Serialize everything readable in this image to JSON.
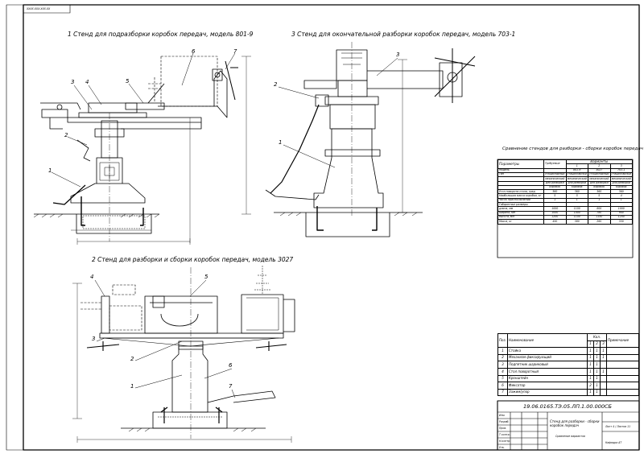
{
  "stamp_top": "ХХХХ.ХХХ.ХХХ.ХХ",
  "view1_title": "1 Стенд для подразборки коробок передач, модель 801-9",
  "view2_title": "2 Стенд для разборки и сборки коробок передач, модель 3027",
  "view3_title": "3 Стенд для окончательной разборки коробок передач, модель 703-1",
  "callouts_v1": [
    "1",
    "2",
    "3",
    "4",
    "5",
    "6",
    "7"
  ],
  "callouts_v2": [
    "1",
    "2",
    "3",
    "4",
    "5",
    "6",
    "7"
  ],
  "callouts_v3": [
    "1",
    "2",
    "3"
  ],
  "comparison": {
    "title": "Сравнение стендов для разборки - сборки коробок передач",
    "col_param": "Параметры",
    "col_req": "Требуемые",
    "col_variants": "Варианты",
    "variant_nums": [
      "1",
      "2",
      "3"
    ],
    "models": [
      "801-9",
      "3027",
      "703-1"
    ],
    "rows": [
      {
        "label": "Модель",
        "req": "",
        "v": [
          "801-9",
          "3027",
          "703-1"
        ]
      },
      {
        "label": "Тип",
        "req": "стационарный",
        "v": [
          "стационарный",
          "стационарный",
          "стационарный"
        ]
      },
      {
        "label": "",
        "req": "механический",
        "v": [
          "механический",
          "механический",
          "механический"
        ]
      },
      {
        "label": "",
        "req": "для разборки",
        "v": [
          "для разборки",
          "для разборки",
          "для разборки"
        ]
      },
      {
        "label": "",
        "req": "коробок",
        "v": [
          "коробок",
          "коробок",
          "коробок"
        ]
      },
      {
        "label": "Угол поворота стола, град",
        "req": "360",
        "v": [
          "360",
          "360",
          "360"
        ]
      },
      {
        "label": "Наибольшая масса коробки, кг",
        "req": "5",
        "v": [
          "5",
          "5",
          "4"
        ]
      },
      {
        "label": "Число приспособлений",
        "req": "1",
        "v": [
          "1",
          "1",
          "1"
        ]
      },
      {
        "label": "Габаритные размеры",
        "req": "",
        "v": [
          "",
          "",
          ""
        ]
      },
      {
        "label": "длина, мм",
        "req": "1000",
        "v": [
          "1100",
          "800",
          "1000"
        ]
      },
      {
        "label": "ширина, мм",
        "req": "1000",
        "v": [
          "1000",
          "780",
          "900"
        ]
      },
      {
        "label": "высота, мм",
        "req": "1200",
        "v": [
          "1100",
          "1150",
          "1200"
        ]
      },
      {
        "label": "Масса, кг",
        "req": "450",
        "v": [
          "380",
          "260",
          "330"
        ]
      }
    ]
  },
  "spec": {
    "headers": [
      "Поз.",
      "Наименование",
      "Кол.",
      "Примечание"
    ],
    "kol_sub": [
      "1",
      "2",
      "3"
    ],
    "rows": [
      {
        "pos": "1",
        "name": "Стойка",
        "q": [
          "1",
          "1",
          "1"
        ]
      },
      {
        "pos": "2",
        "name": "Механизм фиксирующий",
        "q": [
          "1",
          "1",
          "1"
        ]
      },
      {
        "pos": "3",
        "name": "Подпятник шариковый",
        "q": [
          "1",
          "1",
          ""
        ]
      },
      {
        "pos": "4",
        "name": "Стол поворотный",
        "q": [
          "1",
          "1",
          "1"
        ]
      },
      {
        "pos": "5",
        "name": "Кронштейн",
        "q": [
          "1",
          "1",
          ""
        ]
      },
      {
        "pos": "6",
        "name": "Фиксатор",
        "q": [
          "2",
          "1",
          ""
        ]
      },
      {
        "pos": "7",
        "name": "Зажим/упор",
        "q": [
          "1",
          "1",
          ""
        ]
      }
    ]
  },
  "title_block": {
    "code": "19.06.0165.ТЭ.05.ЛП.1.00.000СБ",
    "name": "Стенд для разборки - сборки коробок передач",
    "sub": "Сравнение вариантов",
    "sheet": "Лист 4 / Листов 11",
    "org": "Кафедра АТ",
    "left_rows": [
      "Изм.",
      "Разраб.",
      "Пров.",
      "Т.контр.",
      "Н.контр.",
      "Утв."
    ]
  }
}
